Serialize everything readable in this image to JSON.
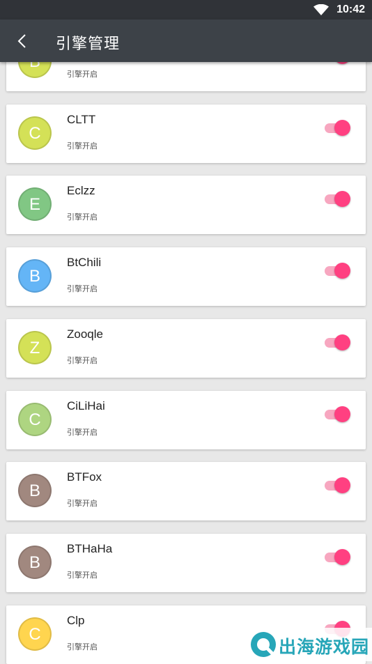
{
  "status_bar": {
    "time": "10:42",
    "wifi_icon": "wifi-icon"
  },
  "app_bar": {
    "back_icon": "chevron-left-icon",
    "title": "引擎管理"
  },
  "colors": {
    "app_bar": "#3d4248",
    "status_bar": "#303338",
    "toggle_on": "#ff4081",
    "toggle_track_on": "#f7a7c0"
  },
  "engines": [
    {
      "letter": "B",
      "name": "",
      "status": "引擎开启",
      "color": "#d4e157",
      "enabled": true
    },
    {
      "letter": "C",
      "name": "CLTT",
      "status": "引擎开启",
      "color": "#d4e157",
      "enabled": true
    },
    {
      "letter": "E",
      "name": "Eclzz",
      "status": "引擎开启",
      "color": "#81c784",
      "enabled": true
    },
    {
      "letter": "B",
      "name": "BtChili",
      "status": "引擎开启",
      "color": "#64b5f6",
      "enabled": true
    },
    {
      "letter": "Z",
      "name": "Zooqle",
      "status": "引擎开启",
      "color": "#d4e157",
      "enabled": true
    },
    {
      "letter": "C",
      "name": "CiLiHai",
      "status": "引擎开启",
      "color": "#aed581",
      "enabled": true
    },
    {
      "letter": "B",
      "name": "BTFox",
      "status": "引擎开启",
      "color": "#a1887f",
      "enabled": true
    },
    {
      "letter": "B",
      "name": "BTHaHa",
      "status": "引擎开启",
      "color": "#a1887f",
      "enabled": true
    },
    {
      "letter": "C",
      "name": "Clp",
      "status": "引擎开启",
      "color": "#ffd54f",
      "enabled": true
    }
  ],
  "watermark": {
    "text": "出海游戏园",
    "logo_icon": "watermark-logo-icon"
  }
}
